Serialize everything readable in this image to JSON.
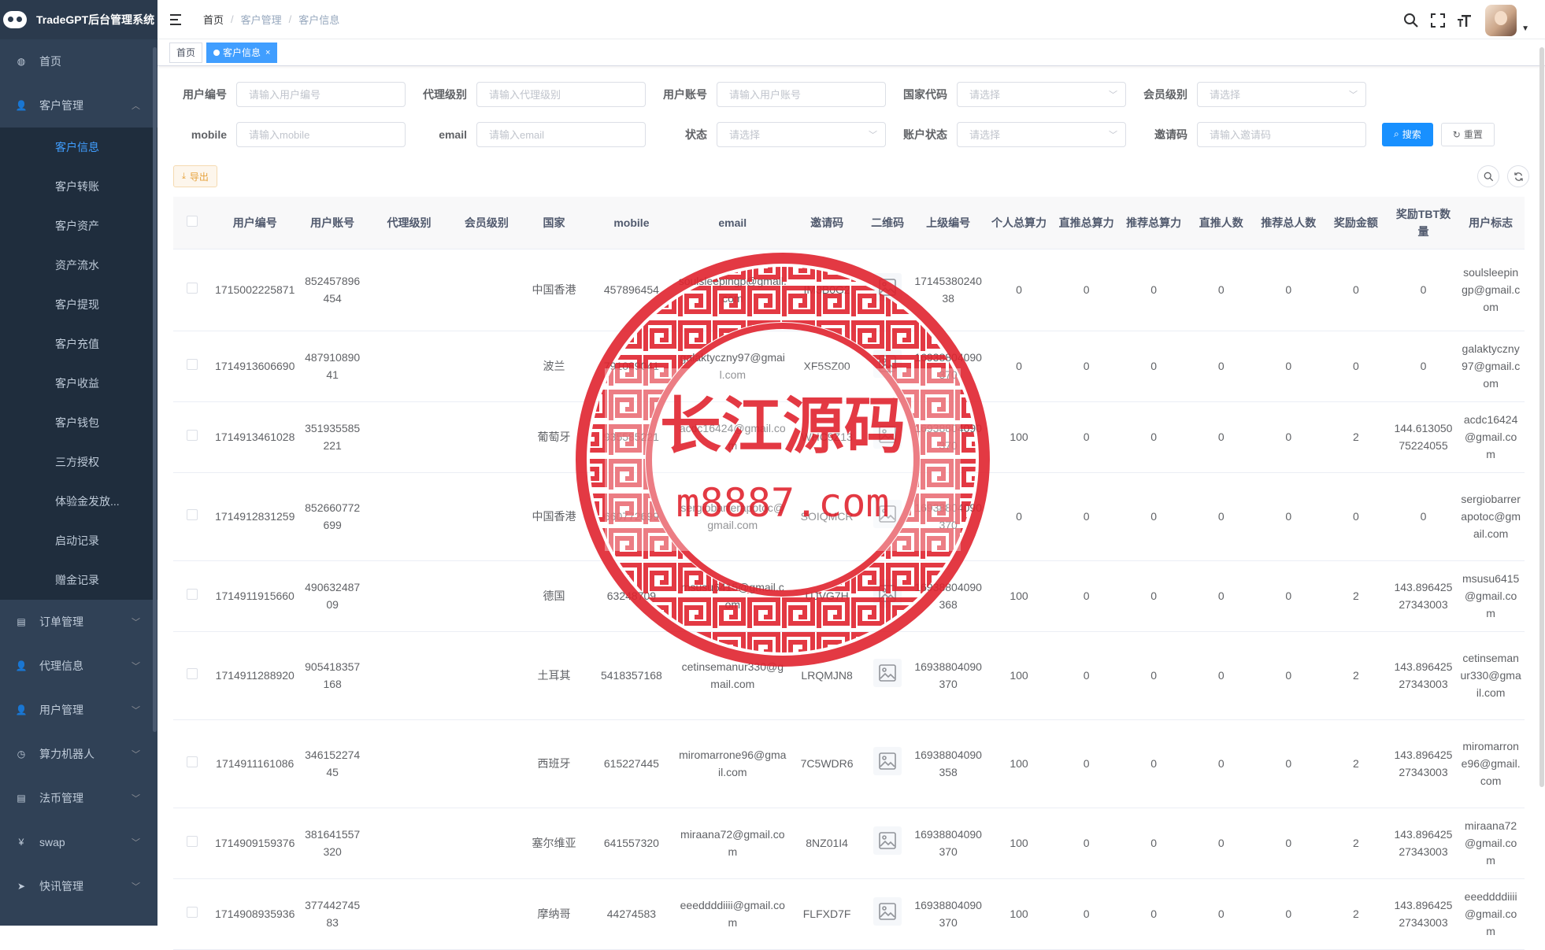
{
  "app": {
    "title": "TradeGPT后台管理系统"
  },
  "sidebar": {
    "items": [
      {
        "label": "首页",
        "icon": "dashboard-icon"
      },
      {
        "label": "客户管理",
        "icon": "user-icon",
        "expanded": true
      },
      {
        "label": "订单管理",
        "icon": "order-icon"
      },
      {
        "label": "代理信息",
        "icon": "agent-icon"
      },
      {
        "label": "用户管理",
        "icon": "user-icon"
      },
      {
        "label": "算力机器人",
        "icon": "clock-icon"
      },
      {
        "label": "法币管理",
        "icon": "document-icon"
      },
      {
        "label": "swap",
        "icon": "yen-icon"
      },
      {
        "label": "快讯管理",
        "icon": "send-icon"
      }
    ],
    "sub_items": [
      "客户信息",
      "客户转账",
      "客户资产",
      "资产流水",
      "客户提现",
      "客户充值",
      "客户收益",
      "客户钱包",
      "三方授权",
      "体验金发放...",
      "启动记录",
      "赠金记录"
    ],
    "active_sub": "客户信息"
  },
  "navbar": {
    "breadcrumb": [
      "首页",
      "客户管理",
      "客户信息"
    ]
  },
  "tags": {
    "home": "首页",
    "active": "客户信息",
    "close": "×"
  },
  "filters": {
    "row1": [
      {
        "label": "用户编号",
        "placeholder": "请输入用户编号",
        "type": "input"
      },
      {
        "label": "代理级别",
        "placeholder": "请输入代理级别",
        "type": "input"
      },
      {
        "label": "用户账号",
        "placeholder": "请输入用户账号",
        "type": "input"
      },
      {
        "label": "国家代码",
        "placeholder": "请选择",
        "type": "select"
      },
      {
        "label": "会员级别",
        "placeholder": "请选择",
        "type": "select"
      }
    ],
    "row2": [
      {
        "label": "mobile",
        "placeholder": "请输入mobile",
        "type": "input"
      },
      {
        "label": "email",
        "placeholder": "请输入email",
        "type": "input"
      },
      {
        "label": "状态",
        "placeholder": "请选择",
        "type": "select"
      },
      {
        "label": "账户状态",
        "placeholder": "请选择",
        "type": "select"
      },
      {
        "label": "邀请码",
        "placeholder": "请输入邀请码",
        "type": "input"
      }
    ],
    "search_label": "搜索",
    "reset_label": "重置"
  },
  "toolbar": {
    "export_label": "导出"
  },
  "table": {
    "columns": [
      "",
      "用户编号",
      "用户账号",
      "代理级别",
      "会员级别",
      "国家",
      "mobile",
      "email",
      "邀请码",
      "二维码",
      "上级编号",
      "个人总算力",
      "直推总算力",
      "推荐总算力",
      "直推人数",
      "推荐总人数",
      "奖励金额",
      "奖励TBT数量",
      "用户标志"
    ],
    "rows": [
      [
        "",
        "1715002225871",
        "852457896454",
        "",
        "",
        "中国香港",
        "457896454",
        "soulsleepingp@gmail.com",
        "IM3B0G2",
        "",
        "1714538024038",
        "0",
        "0",
        "0",
        "0",
        "0",
        "0",
        "0",
        "soulsleepingp@gmail.com"
      ],
      [
        "",
        "1714913606690",
        "48791089041",
        "",
        "",
        "波兰",
        "791089041",
        "galaktyczny97@gmail.com",
        "XF5SZ00",
        "",
        "16938804090370",
        "0",
        "0",
        "0",
        "0",
        "0",
        "0",
        "0",
        "galaktyczny97@gmail.com"
      ],
      [
        "",
        "1714913461028",
        "351935585221",
        "",
        "",
        "葡萄牙",
        "935585221",
        "acdc16424@gmail.com",
        "WHC9Z13",
        "",
        "16938804090370",
        "100",
        "0",
        "0",
        "0",
        "0",
        "2",
        "144.61305075224055",
        "acdc16424@gmail.com"
      ],
      [
        "",
        "1714912831259",
        "852660772699",
        "",
        "",
        "中国香港",
        "660772699",
        "sergiobarrerapotoc@gmail.com",
        "SOIQMCR",
        "",
        "16938804090370",
        "0",
        "0",
        "0",
        "0",
        "0",
        "0",
        "0",
        "sergiobarrerapotoc@gmail.com"
      ],
      [
        "",
        "1714911915660",
        "49063248709",
        "",
        "",
        "德国",
        "63248709",
        "msusu6415@gmail.com",
        "UJVG7H",
        "",
        "16938804090368",
        "100",
        "0",
        "0",
        "0",
        "0",
        "2",
        "143.89642527343003",
        "msusu6415@gmail.com"
      ],
      [
        "",
        "1714911288920",
        "905418357168",
        "",
        "",
        "土耳其",
        "5418357168",
        "cetinsemanur330@gmail.com",
        "LRQMJN8",
        "",
        "16938804090370",
        "100",
        "0",
        "0",
        "0",
        "0",
        "2",
        "143.89642527343003",
        "cetinsemanur330@gmail.com"
      ],
      [
        "",
        "1714911161086",
        "34615227445",
        "",
        "",
        "西班牙",
        "615227445",
        "miromarrone96@gmail.com",
        "7C5WDR6",
        "",
        "16938804090358",
        "100",
        "0",
        "0",
        "0",
        "0",
        "2",
        "143.89642527343003",
        "miromarrone96@gmail.com"
      ],
      [
        "",
        "1714909159376",
        "381641557320",
        "",
        "",
        "塞尔维亚",
        "641557320",
        "miraana72@gmail.com",
        "8NZ01I4",
        "",
        "16938804090370",
        "100",
        "0",
        "0",
        "0",
        "0",
        "2",
        "143.89642527343003",
        "miraana72@gmail.com"
      ],
      [
        "",
        "1714908935936",
        "37744274583",
        "",
        "",
        "摩纳哥",
        "44274583",
        "eeeddddiiii@gmail.com",
        "FLFXD7F",
        "",
        "16938804090370",
        "100",
        "0",
        "0",
        "0",
        "0",
        "2",
        "143.89642527343003",
        "eeeddddiiii@gmail.com"
      ]
    ]
  },
  "watermark": {
    "title": "长江源码",
    "url": "m8887.com",
    "color": "#e0242f"
  }
}
